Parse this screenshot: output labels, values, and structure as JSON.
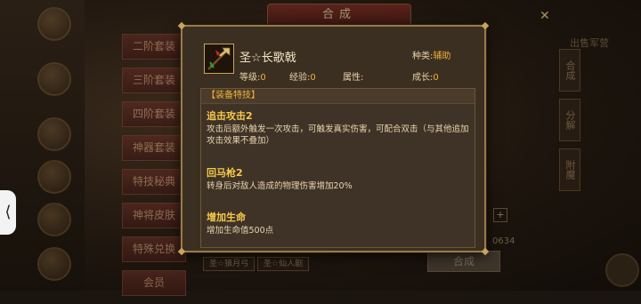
{
  "background": {
    "banner_title": "合成",
    "side_menu": [
      "二阶套装",
      "三阶套装",
      "四阶套装",
      "神器套装",
      "特技秘典",
      "神将皮肤",
      "特殊兑换",
      "会员"
    ],
    "right_tabs": [
      "合成",
      "分解",
      "附魔"
    ],
    "right_title": "出售军营",
    "bottom_chips": [
      "圣☆狼月弓",
      "圣☆仙人剧"
    ],
    "compose_button": "合成",
    "counter": "0634",
    "plus": "+"
  },
  "item": {
    "icon": "halberd-icon",
    "name": "圣☆长歌戟",
    "category_label": "种类:",
    "category_value": "辅助",
    "level_label": "等级:",
    "level_value": "0",
    "exp_label": "经验:",
    "exp_value": "0",
    "attr_label": "属性:",
    "attr_value": "",
    "growth_label": "成长:",
    "growth_value": "0"
  },
  "skills": {
    "header": "【装备特技】",
    "list": [
      {
        "title": "追击攻击2",
        "desc": "攻击后额外触发一次攻击，可触发真实伤害，可配合双击（与其他追加攻击效果不叠加）"
      },
      {
        "title": "回马枪2",
        "desc": "转身后对敌人造成的物理伤害增加20%"
      },
      {
        "title": "增加生命",
        "desc": "增加生命值500点"
      }
    ]
  },
  "colors": {
    "accent": "#f1b23a",
    "skill_title": "#f7c948",
    "border": "#9a7a48"
  }
}
